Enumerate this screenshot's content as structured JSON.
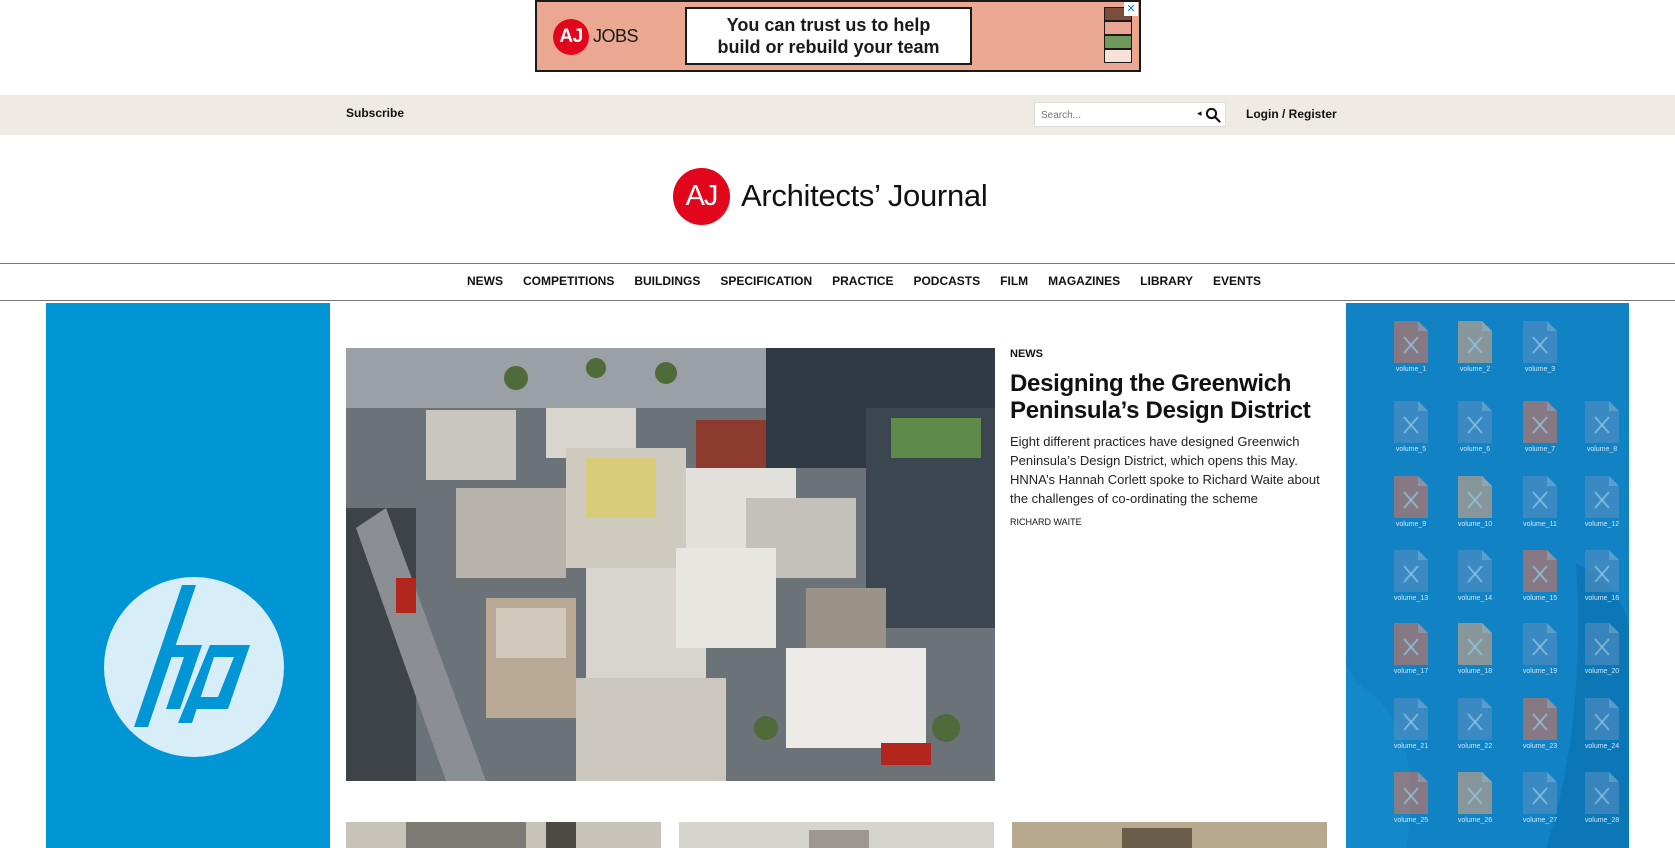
{
  "ad_banner": {
    "logo_mark": "AJ",
    "logo_text": "JOBS",
    "message_line1": "You can trust us to help",
    "message_line2": "build or rebuild your team",
    "close_glyph": "✕",
    "stack_colors": [
      "#7a4e3a",
      "#e9a793",
      "#6f9a5b",
      "#f7e1d8"
    ],
    "background": "#eaa792"
  },
  "utility_bar": {
    "subscribe_label": "Subscribe",
    "search_placeholder": "Search...",
    "search_caret": "◂",
    "search_icon": "search-icon",
    "login_label": "Login / Register",
    "background": "#efebe4"
  },
  "masthead": {
    "logo_mark": "AJ",
    "site_name": "Architects’ Journal",
    "brand_color": "#e1061b"
  },
  "nav": {
    "items": [
      "NEWS",
      "COMPETITIONS",
      "BUILDINGS",
      "SPECIFICATION",
      "PRACTICE",
      "PODCASTS",
      "FILM",
      "MAGAZINES",
      "LIBRARY",
      "EVENTS"
    ]
  },
  "left_ad": {
    "brand": "hp",
    "background": "#0096d6"
  },
  "right_ad": {
    "background": "#1183c4",
    "tiles": [
      {
        "label": "volume_1",
        "color": "#e8724f"
      },
      {
        "label": "volume_2",
        "color": "#e6a77a"
      },
      {
        "label": "volume_3",
        "color": "#5c8fc2"
      },
      {
        "label": "volume_5",
        "color": "#5c8fc2"
      },
      {
        "label": "volume_6",
        "color": "#5c8fc2"
      },
      {
        "label": "volume_7",
        "color": "#e8724f"
      },
      {
        "label": "volume_8",
        "color": "#5c8fc2"
      },
      {
        "label": "volume_9",
        "color": "#e8724f"
      },
      {
        "label": "volume_10",
        "color": "#e6a77a"
      },
      {
        "label": "volume_11",
        "color": "#5c8fc2"
      },
      {
        "label": "volume_12",
        "color": "#5c8fc2"
      },
      {
        "label": "volume_13",
        "color": "#5c8fc2"
      },
      {
        "label": "volume_14",
        "color": "#5c8fc2"
      },
      {
        "label": "volume_15",
        "color": "#e8724f"
      },
      {
        "label": "volume_16",
        "color": "#5c8fc2"
      },
      {
        "label": "volume_17",
        "color": "#e8724f"
      },
      {
        "label": "volume_18",
        "color": "#e6a77a"
      },
      {
        "label": "volume_19",
        "color": "#5c8fc2"
      },
      {
        "label": "volume_20",
        "color": "#5c8fc2"
      },
      {
        "label": "volume_21",
        "color": "#5c8fc2"
      },
      {
        "label": "volume_22",
        "color": "#5c8fc2"
      },
      {
        "label": "volume_23",
        "color": "#e8724f"
      },
      {
        "label": "volume_24",
        "color": "#5c8fc2"
      },
      {
        "label": "volume_25",
        "color": "#e8724f"
      },
      {
        "label": "volume_26",
        "color": "#e6a77a"
      },
      {
        "label": "volume_27",
        "color": "#5c8fc2"
      },
      {
        "label": "volume_28",
        "color": "#5c8fc2"
      }
    ]
  },
  "lead_story": {
    "category": "NEWS",
    "headline": "Designing the Greenwich Peninsula’s Design District",
    "standfirst": "Eight different practices have designed Greenwich Peninsula’s Design District, which opens this May. HNNA’s Hannah Corlett spoke to Richard Waite about the challenges of co-ordinating the scheme",
    "author": "RICHARD WAITE"
  }
}
